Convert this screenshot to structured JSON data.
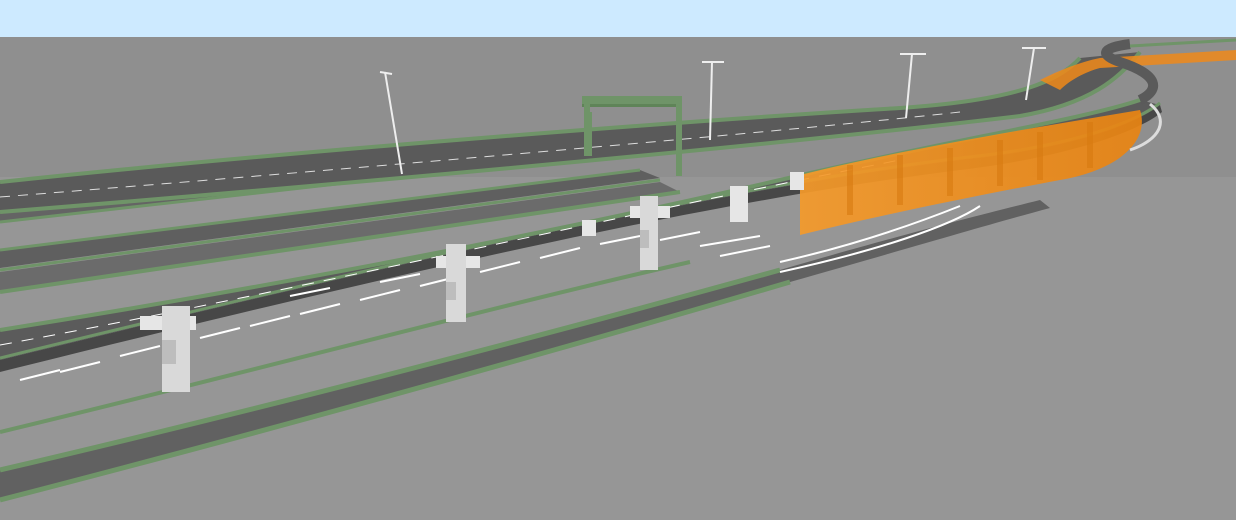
{
  "scene": {
    "sky_color": "#cdeaff",
    "ground_color": "#969696",
    "far_ground_color": "#7d7d7d",
    "asphalt_color": "#5b5b5b",
    "deck_edge_color": "#474747",
    "barrier_color": "#6f9468",
    "noise_barrier_color": "#f08a1a",
    "pier_color": "#e6e6e6",
    "marking_color": "#ffffff",
    "structures": [
      "elevated-curved-viaduct",
      "at-grade-ramp",
      "ground-level-carriageways",
      "sign-gantry",
      "street-light-poles",
      "t-shaped-piers",
      "orange-noise-barrier",
      "parking-bay-markings"
    ]
  }
}
